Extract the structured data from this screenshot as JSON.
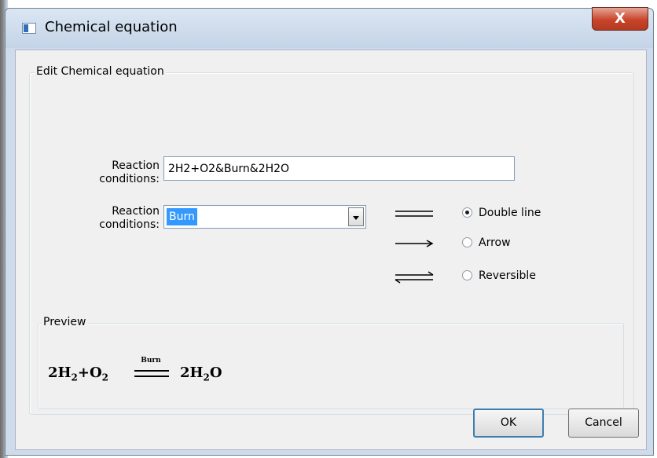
{
  "window": {
    "title": "Chemical equation",
    "close_label": "X"
  },
  "edit_group": {
    "legend": "Edit Chemical equation",
    "equation_label": "Reaction\nconditions:",
    "equation_value": "2H2+O2&Burn&2H2O",
    "condition_label": "Reaction\nconditions:",
    "condition_value": "Burn"
  },
  "line_type": {
    "options": [
      {
        "label": "Double line",
        "symbol": "double-line-icon",
        "checked": true
      },
      {
        "label": "Arrow",
        "symbol": "arrow-icon",
        "checked": false
      },
      {
        "label": "Reversible",
        "symbol": "reversible-icon",
        "checked": false
      }
    ]
  },
  "preview": {
    "legend": "Preview",
    "reactant_1": "2H",
    "reactant_1_sub": "2",
    "plus": "+O",
    "reactant_2_sub": "2",
    "condition": "Burn",
    "product": "2H",
    "product_sub": "2",
    "product_tail": "O"
  },
  "buttons": {
    "ok": "OK",
    "cancel": "Cancel"
  }
}
